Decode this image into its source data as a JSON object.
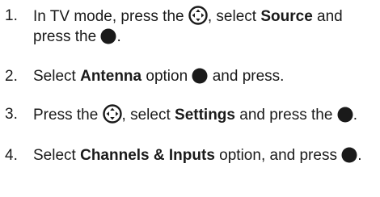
{
  "steps": [
    {
      "number": "1.",
      "t1": "In TV mode, press the",
      "t2": ", select",
      "b1": "Source",
      "t3": "and press the",
      "t4": "."
    },
    {
      "number": "2.",
      "t1": "Select",
      "b1": "Antenna",
      "t2": "option",
      "t3": "and press."
    },
    {
      "number": "3.",
      "t1": "Press the",
      "t2": ", select",
      "b1": "Settings",
      "t3": "and press the",
      "t4": "."
    },
    {
      "number": "4.",
      "t1": "Select",
      "b1": "Channels & Inputs",
      "t2": "option, and press",
      "t3": "."
    }
  ],
  "icons": {
    "navigation": "remote-navigation-pad-icon",
    "ok": "remote-ok-button-icon",
    "color": "#1a1a1a"
  }
}
